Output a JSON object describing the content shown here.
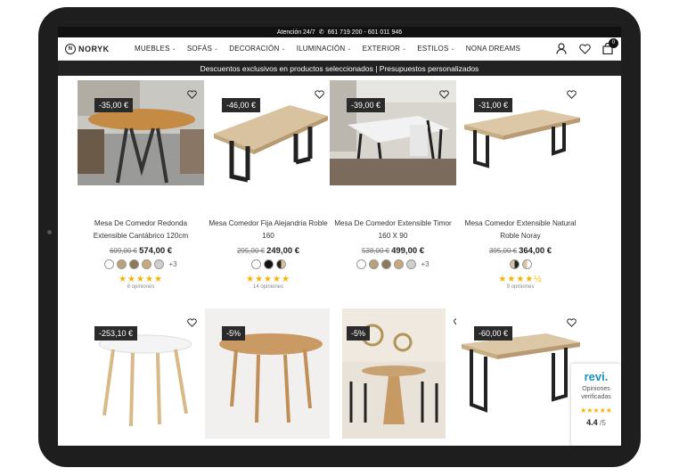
{
  "topbar": {
    "label": "Atención 24/7",
    "phones": "661 719 200 - 601 011 946"
  },
  "brand": {
    "name": "NORYK",
    "sub": "HOME"
  },
  "menu": [
    {
      "label": "MUEBLES",
      "dropdown": true
    },
    {
      "label": "SOFÁS",
      "dropdown": true
    },
    {
      "label": "DECORACIÓN",
      "dropdown": true
    },
    {
      "label": "ILUMINACIÓN",
      "dropdown": true
    },
    {
      "label": "EXTERIOR",
      "dropdown": true
    },
    {
      "label": "ESTILOS",
      "dropdown": true
    },
    {
      "label": "NONA DREAMS",
      "dropdown": false
    }
  ],
  "cart": {
    "count": "0"
  },
  "promo": "Descuentos exclusivos en productos seleccionados | Presupuestos personalizados",
  "products": [
    {
      "discount": "-35,00 €",
      "title": "Mesa De Comedor Redonda Extensible Cantábrico 120cm",
      "old_price": "609,00 €",
      "price": "574,00 €",
      "swatches": [
        "#ffffff",
        "#b9a27a",
        "#8a7a58",
        "#c9a97c",
        "#cfcfcf"
      ],
      "more": "+3",
      "stars": "★★★★★",
      "rating": 5,
      "reviews": "8 opiniones"
    },
    {
      "discount": "-46,00 €",
      "title": "Mesa Comedor Fija Alejandria Roble 160",
      "old_price": "295,00 €",
      "price": "249,00 €",
      "swatches": [
        "#ffffff",
        "#111111",
        "half"
      ],
      "more": "",
      "stars": "★★★★★",
      "rating": 5,
      "reviews": "14 opiniones"
    },
    {
      "discount": "-39,00 €",
      "title": "Mesa De Comedor Extensible Timor 160 X 90",
      "old_price": "538,00 €",
      "price": "499,00 €",
      "swatches": [
        "#ffffff",
        "#b9a27a",
        "#8a7a58",
        "#c9a97c",
        "#cfcfcf"
      ],
      "more": "+3",
      "stars": "",
      "rating": 0,
      "reviews": ""
    },
    {
      "discount": "-31,00 €",
      "title": "Mesa Comedor Extensible Natural Roble Noray",
      "old_price": "395,00 €",
      "price": "364,00 €",
      "swatches": [
        "half-dark",
        "half"
      ],
      "more": "",
      "stars": "★★★★½",
      "rating": 4.5,
      "reviews": "9 opiniones"
    },
    {
      "discount": "-253,10 €"
    },
    {
      "discount": "-5%"
    },
    {
      "discount": "-5%"
    },
    {
      "discount": "-60,00 €"
    }
  ],
  "revi": {
    "logo": "revi.",
    "label": "Opiniones verificadas",
    "stars": "★★★★★",
    "score": "4.4",
    "scale": "/5"
  }
}
